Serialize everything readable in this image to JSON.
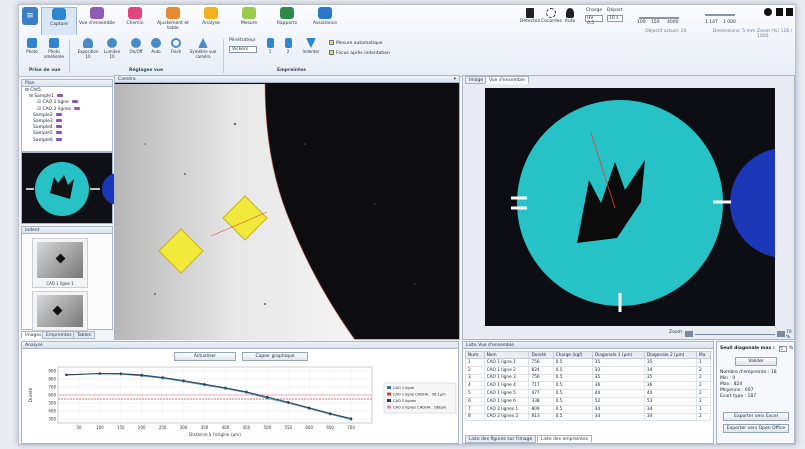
{
  "ribbon": {
    "tabs": [
      "Capture",
      "Vue d'ensemble",
      "Chemin",
      "Ajustement et table",
      "Analyse",
      "Mesure",
      "Rapports",
      "Assistance"
    ],
    "tab_colors": [
      "#2f86d0",
      "#8e5bb5",
      "#e0457b",
      "#e58a2e",
      "#f1b21e",
      "#9acb4a",
      "#2f8a4a",
      "#2a78c9"
    ],
    "right_icons": [
      "Détectez",
      "Cocardes",
      "Auto"
    ],
    "charge_label": "Charge",
    "dep_label": "Départ",
    "charge_val": "HV 0.5",
    "dep_val": "10 s",
    "zoom_ticks": [
      "100",
      "150",
      "4000"
    ],
    "zoom_note": "Objectif actuel: 20",
    "dims_ticks": [
      "1 147",
      "1 000"
    ],
    "dims_note": "Dimensions: 5 mm",
    "right_note": "Zoom (%) 116 / 1000",
    "groups": {
      "first": {
        "items": [
          "Photo",
          "Photo améliorée"
        ],
        "label": "Prise de vue"
      },
      "reglages": {
        "items": [
          "Exposition 10",
          "Lumière 10",
          "On/Off",
          "Auto",
          "Flash",
          "Symétrie vue caméra"
        ],
        "label": "Réglages vue"
      },
      "emp": {
        "mode_label": "Pénétrateur",
        "mode_val": "Vickers",
        "items": [
          "1",
          "2",
          "Indenter"
        ],
        "label": "Empreintes"
      },
      "checks": [
        "Mesure automatique",
        "Focus après indentation"
      ]
    }
  },
  "left": {
    "tree_title": "Plan",
    "tree_root": "Cht5",
    "tree_sample": "Sample1",
    "tree_lines": [
      "CAO 1 ligne",
      "CAO 2 lignes"
    ],
    "tree_samples": [
      "Sample2",
      "Sample3",
      "Sample4",
      "Sample5",
      "Sample6"
    ],
    "thumbs_title": "Indent",
    "thumb1": "CAO 1 ligne 1",
    "tabs": [
      "Images",
      "Empreintes",
      "Tables"
    ]
  },
  "camera": {
    "title": "Caméra"
  },
  "overview": {
    "tabs": [
      "Image",
      "Vue d'ensemble"
    ],
    "zoom_label": "Zoom",
    "zoom_val": "70 %"
  },
  "analysis": {
    "title": "Analyse",
    "btn_update": "Actualiser",
    "btn_copy": "Copier graphique"
  },
  "chart_data": {
    "type": "line",
    "x": [
      20,
      100,
      150,
      200,
      250,
      300,
      350,
      400,
      450,
      500,
      550,
      600,
      650,
      700
    ],
    "xticks": [
      50,
      100,
      150,
      200,
      250,
      300,
      350,
      400,
      450,
      500,
      550,
      600,
      650,
      700
    ],
    "yticks": [
      300,
      400,
      500,
      600,
      700,
      800,
      900
    ],
    "xlim": [
      0,
      750
    ],
    "ylim": [
      250,
      950
    ],
    "xlabel": "Distance à l'origine (µm)",
    "ylabel": "Dureté",
    "legend": [
      "CAO 1 ligne",
      "CAO 1 ligne CHDHA : 56.1µm",
      "CAO 2 lignes",
      "CAO 2 lignes CHDHA : 168µm"
    ],
    "series": [
      {
        "color": "#2a7fa0",
        "values": [
          855,
          865,
          860,
          840,
          810,
          770,
          725,
          680,
          630,
          560,
          500,
          430,
          360,
          295
        ]
      },
      {
        "color": "#2f3a56",
        "values": [
          850,
          870,
          868,
          850,
          820,
          780,
          735,
          690,
          640,
          575,
          510,
          440,
          370,
          305
        ]
      }
    ],
    "threshold_red": 550,
    "threshold_pink": 600
  },
  "table": {
    "title": "Liste Vue d'ensemble",
    "columns": [
      "Num",
      "Nom",
      "Dureté",
      "Charge (kgf)",
      "Diagonale 1 (µm)",
      "Diagonale 2 (µm)",
      "Ma"
    ],
    "rows": [
      [
        "1",
        "CAO 1 ligne 1",
        "756",
        "0.5",
        "35",
        "35",
        "1"
      ],
      [
        "2",
        "CAO 1 ligne 2",
        "824",
        "0.5",
        "33",
        "34",
        "2"
      ],
      [
        "3",
        "CAO 1 ligne 3",
        "756",
        "0.5",
        "35",
        "35",
        "2"
      ],
      [
        "4",
        "CAO 1 ligne 4",
        "717",
        "0.5",
        "36",
        "36",
        "2"
      ],
      [
        "5",
        "CAO 1 ligne 5",
        "477",
        "0.5",
        "44",
        "44",
        "2"
      ],
      [
        "6",
        "CAO 1 ligne 6",
        "338",
        "0.5",
        "52",
        "53",
        "2"
      ],
      [
        "7",
        "CAO 2 lignes 1",
        "809",
        "0.5",
        "34",
        "34",
        "1"
      ],
      [
        "8",
        "CAO 2 lignes 2",
        "813",
        "0.5",
        "34",
        "34",
        "2"
      ]
    ],
    "tabs": [
      "Liste des figures sur l'image",
      "Liste des empreintes"
    ]
  },
  "right_panel": {
    "title": "Seuil diagonale max :",
    "title_val": "5",
    "unit": "%",
    "btn_apply": "Valider",
    "stats": [
      "Nombre d'empreinte : 18",
      "Min : 0",
      "Max : 824",
      "Moyenne : 697",
      "Ecart type : 187"
    ],
    "btn_excel": "Exporter vers Excel",
    "btn_office": "Exporter vers Open Office"
  }
}
